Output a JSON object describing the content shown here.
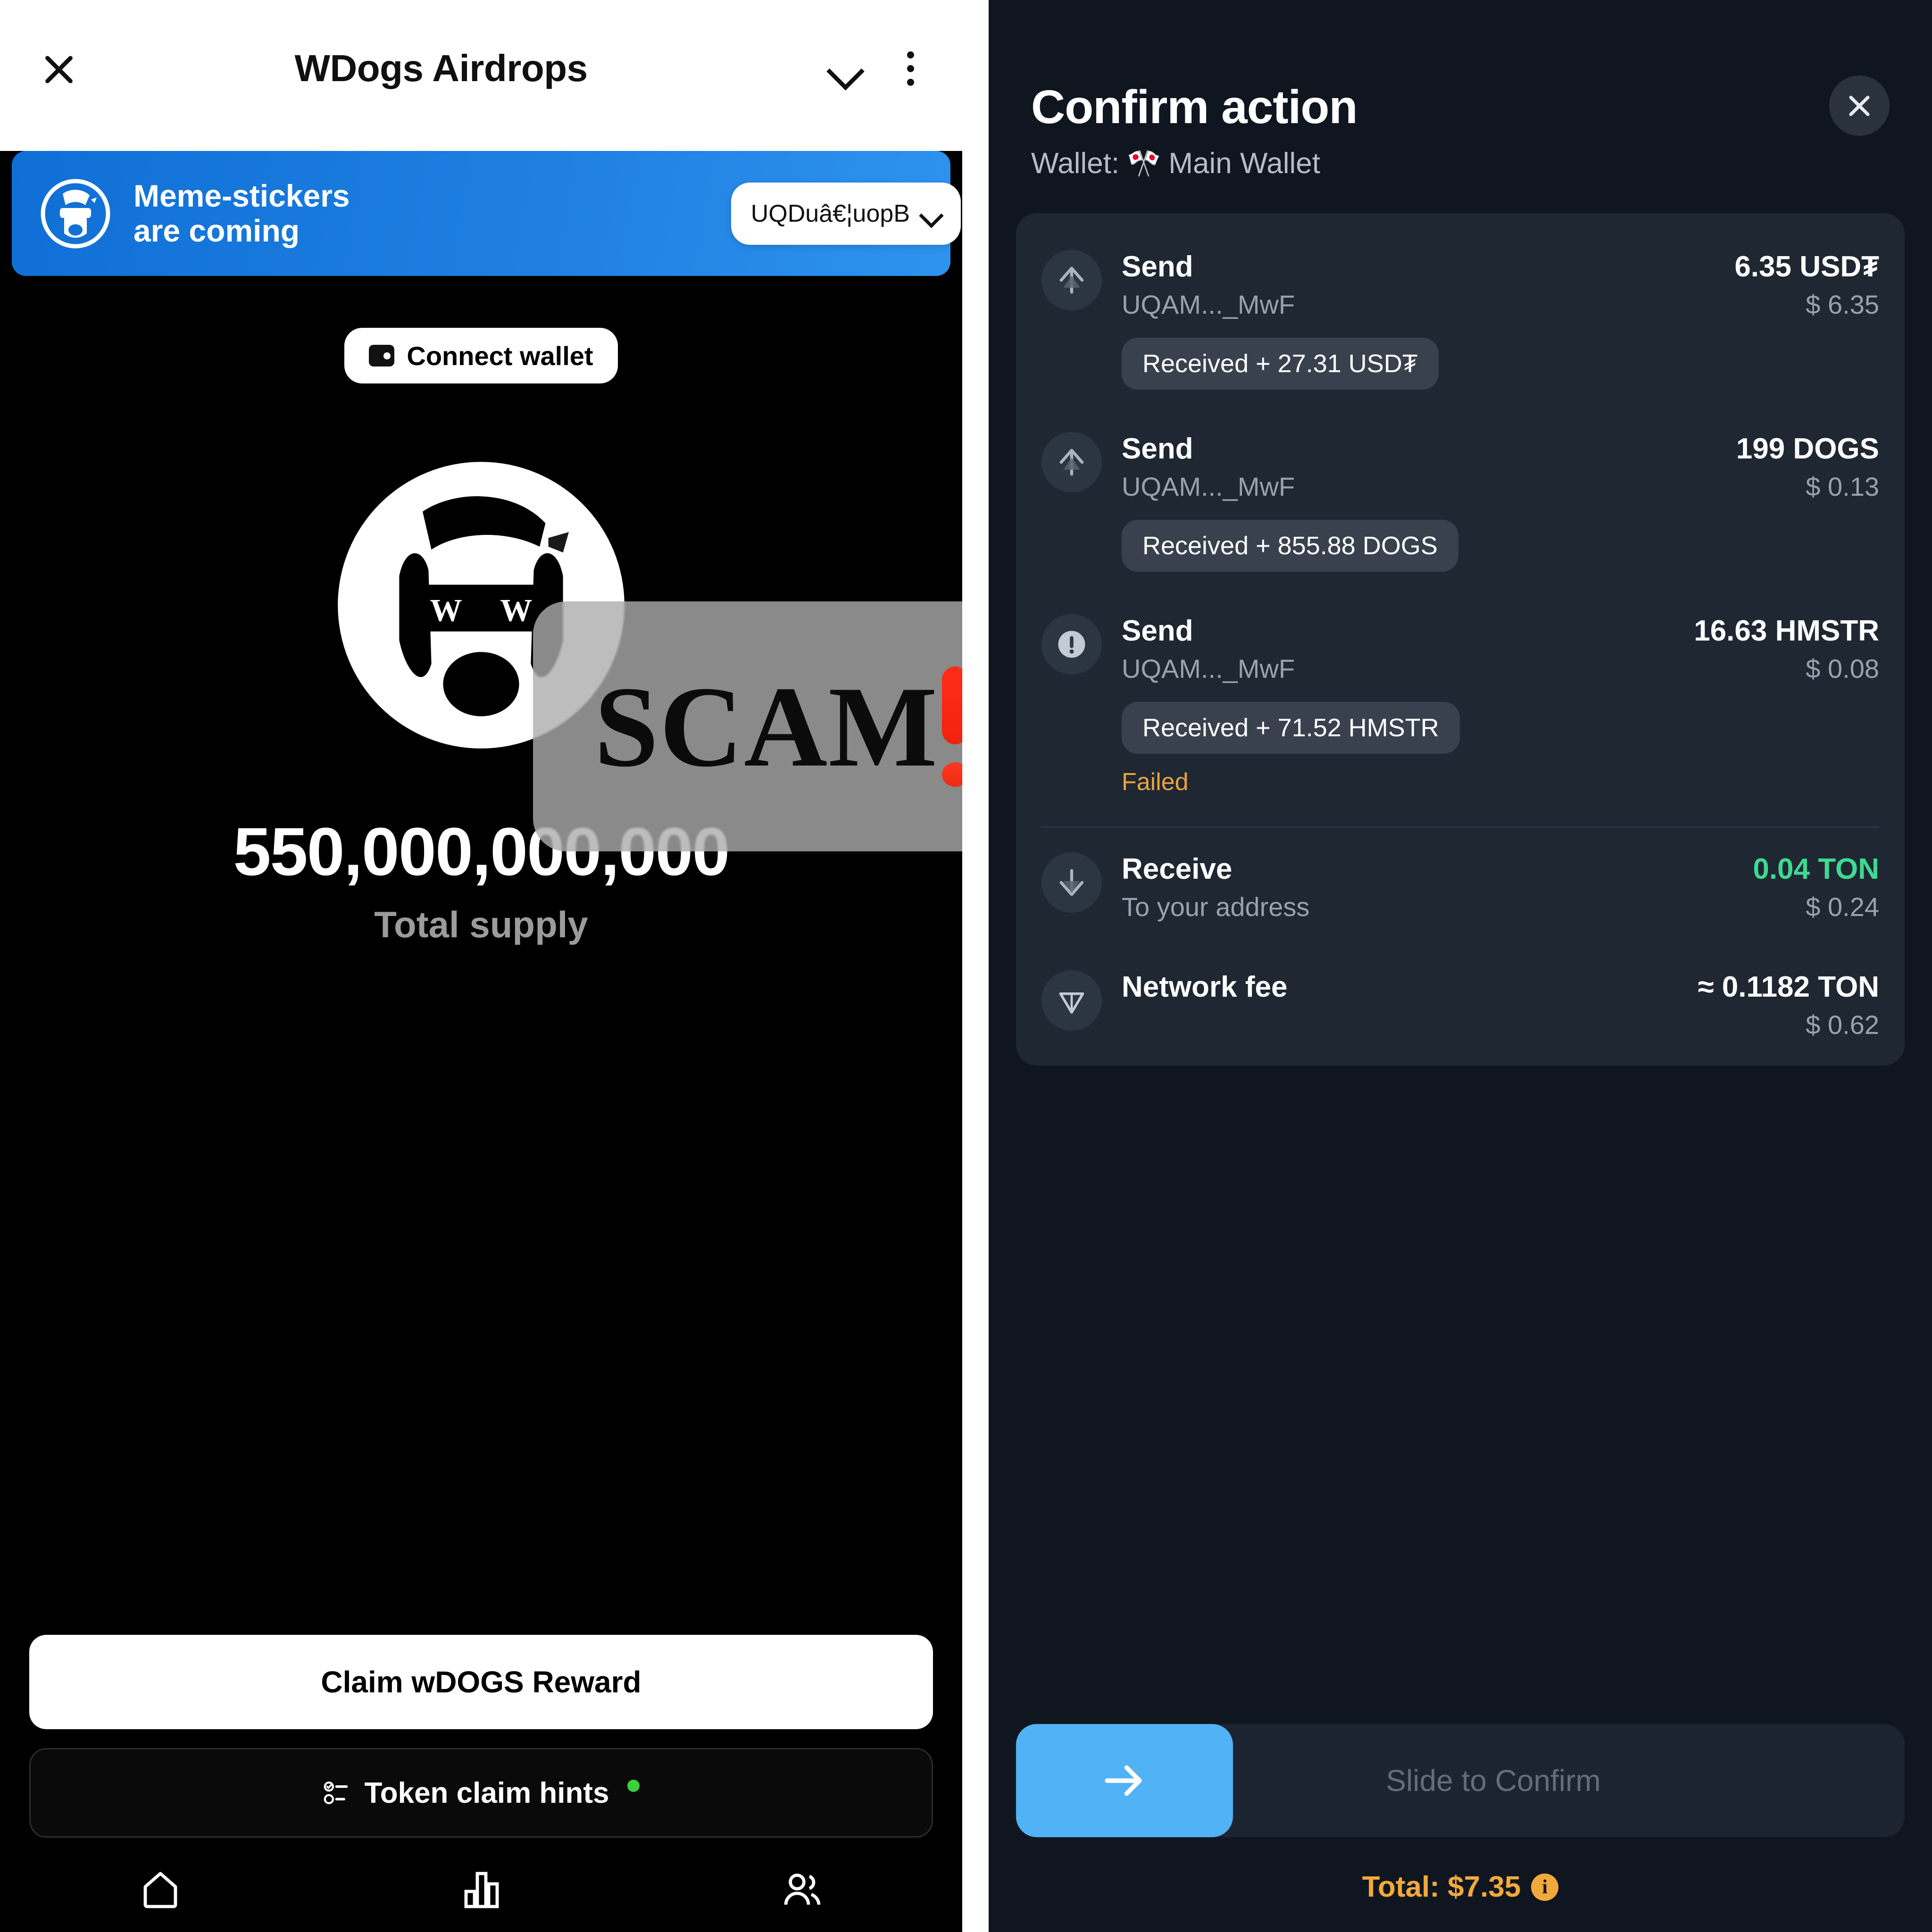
{
  "left_app": {
    "header": {
      "title": "WDogs Airdrops",
      "close_icon": "close-icon",
      "collapse_icon": "chevron-down-icon",
      "menu_icon": "more-vertical-icon"
    },
    "banner": {
      "text": "Meme-stickers\nare coming",
      "logo_icon": "wdogs-logo-icon",
      "address_pill": {
        "label": "UQDuâ€¦uopB",
        "chevron_icon": "chevron-down-icon"
      }
    },
    "connect_button": {
      "label": "Connect wallet",
      "icon": "wallet-icon"
    },
    "mascot_icon": "wdogs-mascot-icon",
    "supply": {
      "value": "550,000,000,000",
      "label": "Total supply"
    },
    "claim_button": {
      "label": "Claim wDOGS Reward"
    },
    "hints_button": {
      "label": "Token claim hints",
      "icon": "checklist-icon",
      "badge_color": "#3ad13a"
    },
    "tabbar": [
      {
        "name": "home",
        "icon": "home-icon"
      },
      {
        "name": "stats",
        "icon": "bar-chart-icon"
      },
      {
        "name": "friends",
        "icon": "people-icon"
      }
    ],
    "scam_overlay": {
      "text": "SCAM",
      "emoji": "double-exclamation-icon",
      "accent_color": "#ff2d18"
    }
  },
  "right_app": {
    "title": "Confirm action",
    "wallet_prefix": "Wallet:",
    "wallet_flag": "🎌",
    "wallet_name": "Main Wallet",
    "close_icon": "close-icon",
    "transactions": [
      {
        "icon": "arrow-up-icon",
        "title": "Send",
        "address": "UQAM..._MwF",
        "amount": "6.35 USD₮",
        "fiat": "$ 6.35",
        "received_pill": "Received + 27.31 USD₮",
        "status": "",
        "amount_color": "#ffffff"
      },
      {
        "icon": "arrow-up-icon",
        "title": "Send",
        "address": "UQAM..._MwF",
        "amount": "199 DOGS",
        "fiat": "$ 0.13",
        "received_pill": "Received + 855.88 DOGS",
        "status": "",
        "amount_color": "#ffffff"
      },
      {
        "icon": "warning-icon",
        "title": "Send",
        "address": "UQAM..._MwF",
        "amount": "16.63 HMSTR",
        "fiat": "$ 0.08",
        "received_pill": "Received + 71.52 HMSTR",
        "status": "Failed",
        "amount_color": "#ffffff"
      },
      {
        "icon": "arrow-down-icon",
        "title": "Receive",
        "address": "To your address",
        "amount": "0.04 TON",
        "fiat": "$ 0.24",
        "received_pill": "",
        "status": "",
        "amount_color": "#3fd992"
      },
      {
        "icon": "ton-diamond-icon",
        "title": "Network fee",
        "address": "",
        "amount": "≈ 0.1182 TON",
        "fiat": "$ 0.62",
        "received_pill": "",
        "status": "",
        "amount_color": "#ffffff"
      }
    ],
    "slider": {
      "label": "Slide to Confirm",
      "handle_icon": "arrow-right-icon",
      "handle_color": "#51b2f5"
    },
    "total": {
      "label": "Total: $7.35",
      "info_icon": "info-icon",
      "color": "#f2a93b"
    }
  }
}
